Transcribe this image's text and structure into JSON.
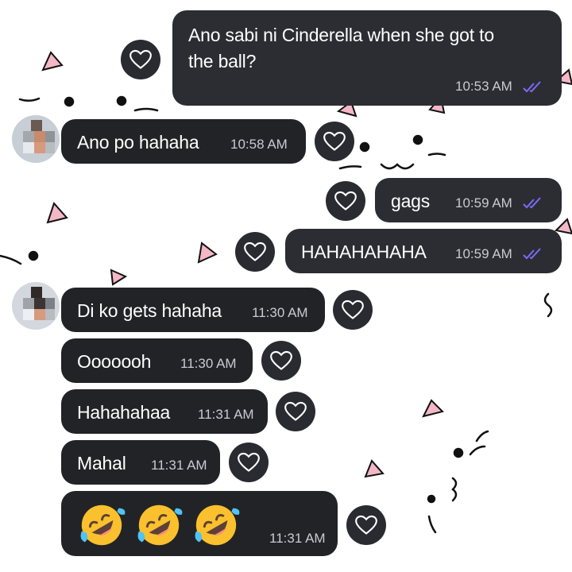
{
  "chat": {
    "messages": [
      {
        "side": "out",
        "text_line1": "Ano sabi ni Cinderella when she got to",
        "text_line2": "the ball?",
        "time": "10:53 AM",
        "status": "read"
      },
      {
        "side": "in",
        "text": "Ano po hahaha",
        "time": "10:58 AM"
      },
      {
        "side": "out",
        "text": "gags",
        "time": "10:59 AM",
        "status": "read"
      },
      {
        "side": "out",
        "text": "HAHAHAHAHA",
        "time": "10:59 AM",
        "status": "read"
      },
      {
        "side": "in",
        "text": "Di ko gets hahaha",
        "time": "11:30 AM"
      },
      {
        "side": "in",
        "text": "Ooooooh",
        "time": "11:30 AM"
      },
      {
        "side": "in",
        "text": "Hahahahaa",
        "time": "11:31 AM"
      },
      {
        "side": "in",
        "text": "Mahal",
        "time": "11:31 AM"
      },
      {
        "side": "in",
        "emojis": [
          "rolling-on-floor-laughing",
          "rolling-on-floor-laughing",
          "rolling-on-floor-laughing"
        ],
        "time": "11:31 AM"
      }
    ]
  },
  "icons": {
    "reaction": "heart-outline-icon",
    "read_status": "double-check-icon",
    "avatar": "pixelated-avatar"
  },
  "colors": {
    "bubble": "#2b2d33",
    "read_ticks": "#7b6cf6",
    "background": "#ffffff"
  }
}
